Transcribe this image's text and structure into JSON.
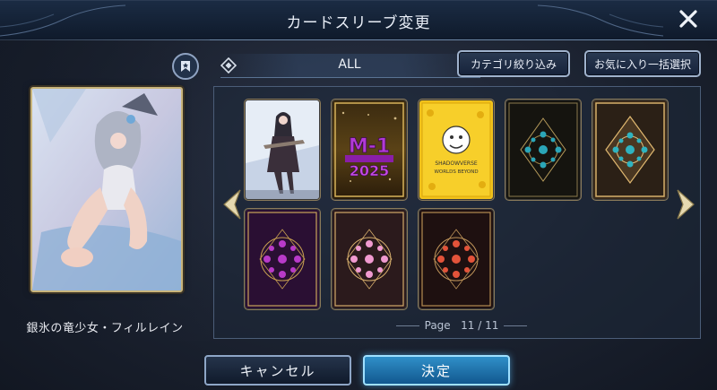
{
  "header": {
    "title": "カードスリーブ変更",
    "close_icon": "close-icon"
  },
  "preview": {
    "name": "銀氷の竜少女・フィルレイン"
  },
  "filter": {
    "category": "ALL",
    "category_filter_label": "カテゴリ絞り込み",
    "favorite_select_label": "お気に入り一括選択"
  },
  "sleeves": [
    {
      "name": "sleeve-silver-girl",
      "style": "art"
    },
    {
      "name": "sleeve-m1-2025",
      "style": "m1"
    },
    {
      "name": "sleeve-worlds-beyond",
      "style": "yellow"
    },
    {
      "name": "sleeve-ornate-teal-dark",
      "style": "teal-dark"
    },
    {
      "name": "sleeve-ornate-teal-gold",
      "style": "teal-gold"
    },
    {
      "name": "sleeve-ornate-purple",
      "style": "purple"
    },
    {
      "name": "sleeve-ornate-pink",
      "style": "pink"
    },
    {
      "name": "sleeve-ornate-red",
      "style": "red"
    }
  ],
  "card_texts": {
    "m1_big": "M-1",
    "m1_year": "2025",
    "yellow_top": "SHADOWVERSE",
    "yellow_bottom": "WORLDS BEYOND"
  },
  "pagination": {
    "label": "Page",
    "value": "11 / 11"
  },
  "footer": {
    "cancel_label": "キャンセル",
    "ok_label": "決定"
  },
  "colors": {
    "accent": "#2f8fc8",
    "frame_gold": "#c8b47a",
    "panel": "#1b2230"
  }
}
